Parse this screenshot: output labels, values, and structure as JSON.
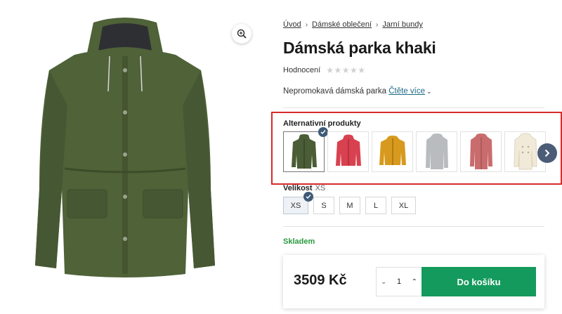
{
  "breadcrumb": [
    {
      "label": "Úvod"
    },
    {
      "label": "Dámské oblečení"
    },
    {
      "label": "Jarní bundy"
    }
  ],
  "product": {
    "title": "Dámská parka khaki",
    "rating_label": "Hodnocení",
    "rating_stars": "★★★★★",
    "description": "Nepromokavá dámská parka",
    "read_more": "Čtěte více"
  },
  "alternatives": {
    "title": "Alternativní produkty",
    "items": [
      {
        "name": "khaki parka",
        "color": "#4a5d36",
        "selected": true
      },
      {
        "name": "red jacket",
        "color": "#d8414f",
        "selected": false
      },
      {
        "name": "mustard jacket",
        "color": "#d79a1e",
        "selected": false
      },
      {
        "name": "grey coat",
        "color": "#b9bcbf",
        "selected": false
      },
      {
        "name": "pink coat",
        "color": "#c96c6e",
        "selected": false
      },
      {
        "name": "white coat",
        "color": "#f1ead8",
        "selected": false
      }
    ]
  },
  "size": {
    "label": "Velikost",
    "selected": "XS",
    "options": [
      "XS",
      "S",
      "M",
      "L",
      "XL"
    ]
  },
  "stock": "Skladem",
  "buy": {
    "price": "3509 Kč",
    "quantity": "1",
    "cart_label": "Do košíku"
  },
  "colors": {
    "accent": "#149a5c",
    "stock": "#2a9a3d",
    "highlight_border": "#d62b2b",
    "check_badge": "#3e5a78",
    "jacket": "#4f6238"
  },
  "icons": {
    "zoom": "zoom-in-icon",
    "next": "chevron-right-icon",
    "check": "check-icon"
  }
}
